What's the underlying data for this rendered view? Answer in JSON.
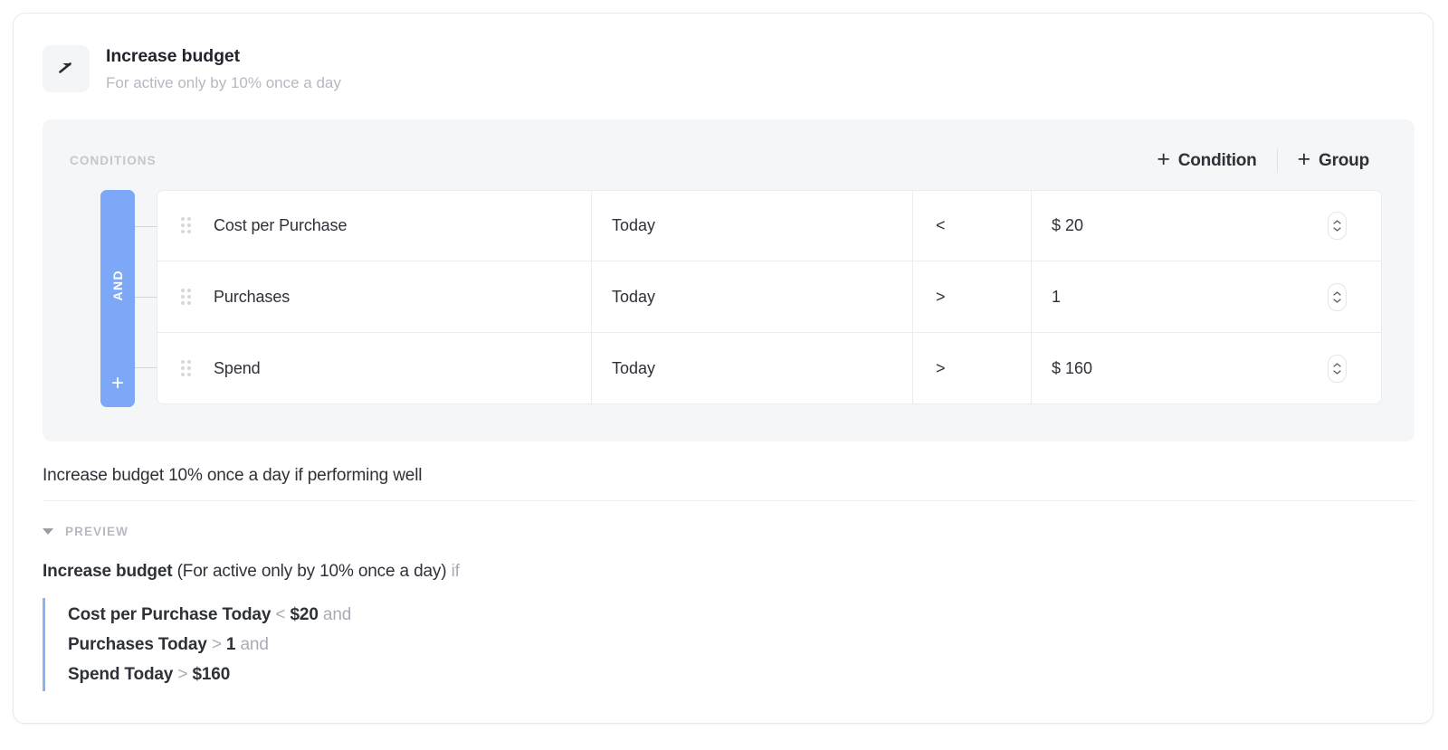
{
  "rule": {
    "icon": "trending-up-arrow-icon",
    "title": "Increase budget",
    "subtitle": "For active only by 10% once a day",
    "description": "Increase budget 10% once a day if performing well"
  },
  "conditions_panel": {
    "label": "CONDITIONS",
    "add_condition_label": "Condition",
    "add_group_label": "Group",
    "plus_glyph": "+",
    "group_operator": "AND",
    "group_add_glyph": "+",
    "columns": [
      "metric",
      "window",
      "operator",
      "value"
    ],
    "rows": [
      {
        "metric": "Cost per Purchase",
        "window": "Today",
        "operator": "<",
        "value": "$ 20"
      },
      {
        "metric": "Purchases",
        "window": "Today",
        "operator": ">",
        "value": "1"
      },
      {
        "metric": "Spend",
        "window": "Today",
        "operator": ">",
        "value": "$ 160"
      }
    ]
  },
  "preview": {
    "label": "PREVIEW",
    "expanded": true,
    "summary": {
      "action": "Increase budget",
      "detail": "(For active only by 10% once a day)",
      "connector": "if"
    },
    "lines": [
      {
        "subject": "Cost per Purchase Today",
        "operator": "<",
        "value": "$20",
        "connector": "and"
      },
      {
        "subject": "Purchases Today",
        "operator": ">",
        "value": "1",
        "connector": "and"
      },
      {
        "subject": "Spend Today",
        "operator": ">",
        "value": "$160",
        "connector": ""
      }
    ]
  },
  "colors": {
    "group_blue": "#7da7f7",
    "preview_border_blue": "#8fb0f5",
    "panel_bg": "#f5f6f8",
    "text": "#2e3138",
    "muted": "#a9acb4"
  }
}
